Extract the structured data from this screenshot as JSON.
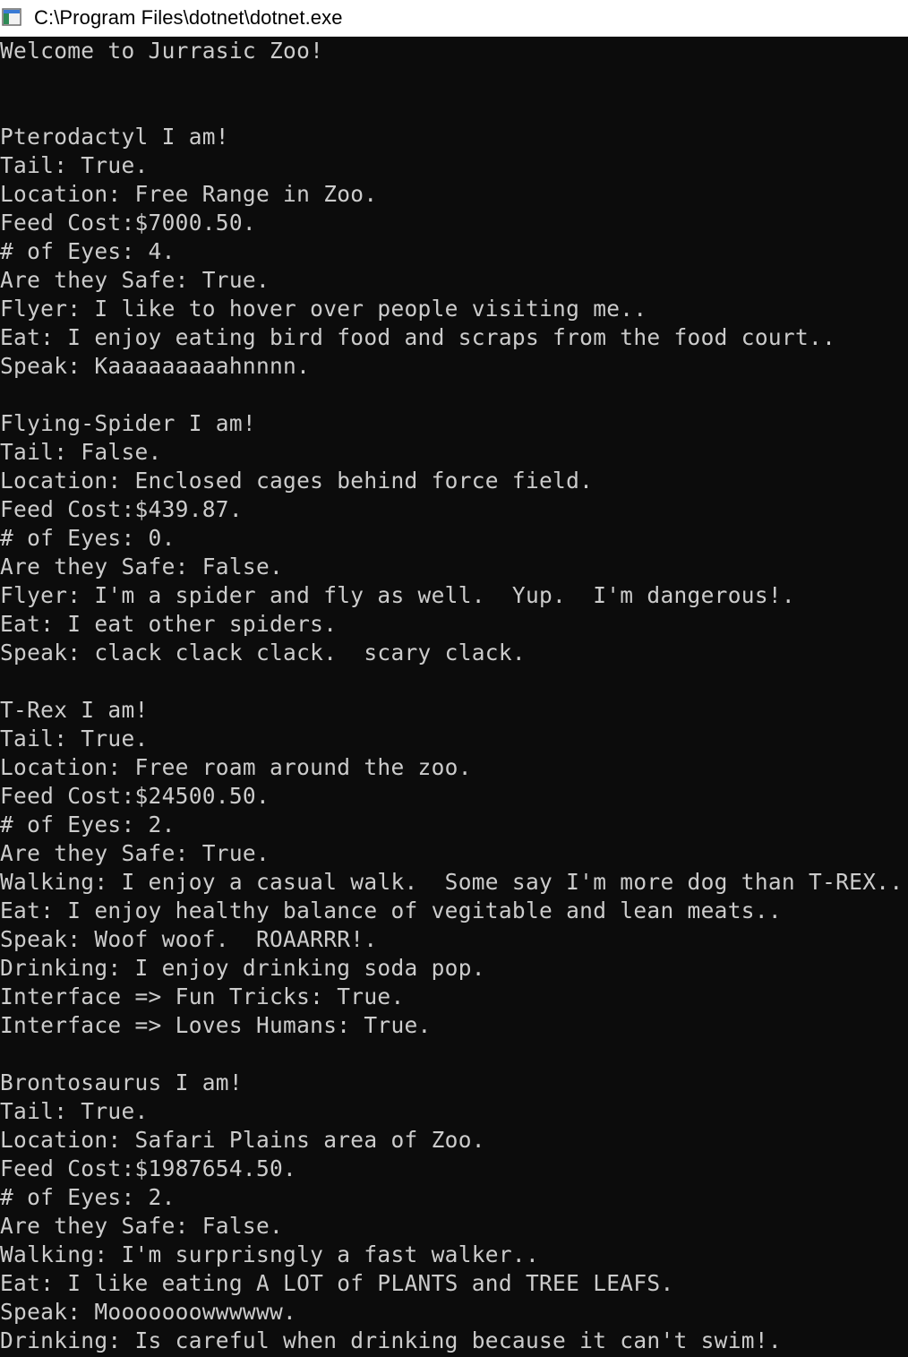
{
  "window": {
    "title": "C:\\Program Files\\dotnet\\dotnet.exe"
  },
  "console": {
    "lines": [
      "Welcome to Jurrasic Zoo!",
      "",
      "",
      "Pterodactyl I am!",
      "Tail: True.",
      "Location: Free Range in Zoo.",
      "Feed Cost:$7000.50.",
      "# of Eyes: 4.",
      "Are they Safe: True.",
      "Flyer: I like to hover over people visiting me..",
      "Eat: I enjoy eating bird food and scraps from the food court..",
      "Speak: Kaaaaaaaaahnnnn.",
      "",
      "Flying-Spider I am!",
      "Tail: False.",
      "Location: Enclosed cages behind force field.",
      "Feed Cost:$439.87.",
      "# of Eyes: 0.",
      "Are they Safe: False.",
      "Flyer: I'm a spider and fly as well.  Yup.  I'm dangerous!.",
      "Eat: I eat other spiders.",
      "Speak: clack clack clack.  scary clack.",
      "",
      "T-Rex I am!",
      "Tail: True.",
      "Location: Free roam around the zoo.",
      "Feed Cost:$24500.50.",
      "# of Eyes: 2.",
      "Are they Safe: True.",
      "Walking: I enjoy a casual walk.  Some say I'm more dog than T-REX..",
      "Eat: I enjoy healthy balance of vegitable and lean meats..",
      "Speak: Woof woof.  ROAARRR!.",
      "Drinking: I enjoy drinking soda pop.",
      "Interface => Fun Tricks: True.",
      "Interface => Loves Humans: True.",
      "",
      "Brontosaurus I am!",
      "Tail: True.",
      "Location: Safari Plains area of Zoo.",
      "Feed Cost:$1987654.50.",
      "# of Eyes: 2.",
      "Are they Safe: False.",
      "Walking: I'm surprisngly a fast walker..",
      "Eat: I like eating A LOT of PLANTS and TREE LEAFS.",
      "Speak: Mooooooowwwwww.",
      "Drinking: Is careful when drinking because it can't swim!."
    ]
  },
  "colors": {
    "console_bg": "#0c0c0c",
    "console_fg": "#cccccc",
    "titlebar_bg": "#ffffff"
  },
  "icons": {
    "app": "console-app-icon"
  }
}
